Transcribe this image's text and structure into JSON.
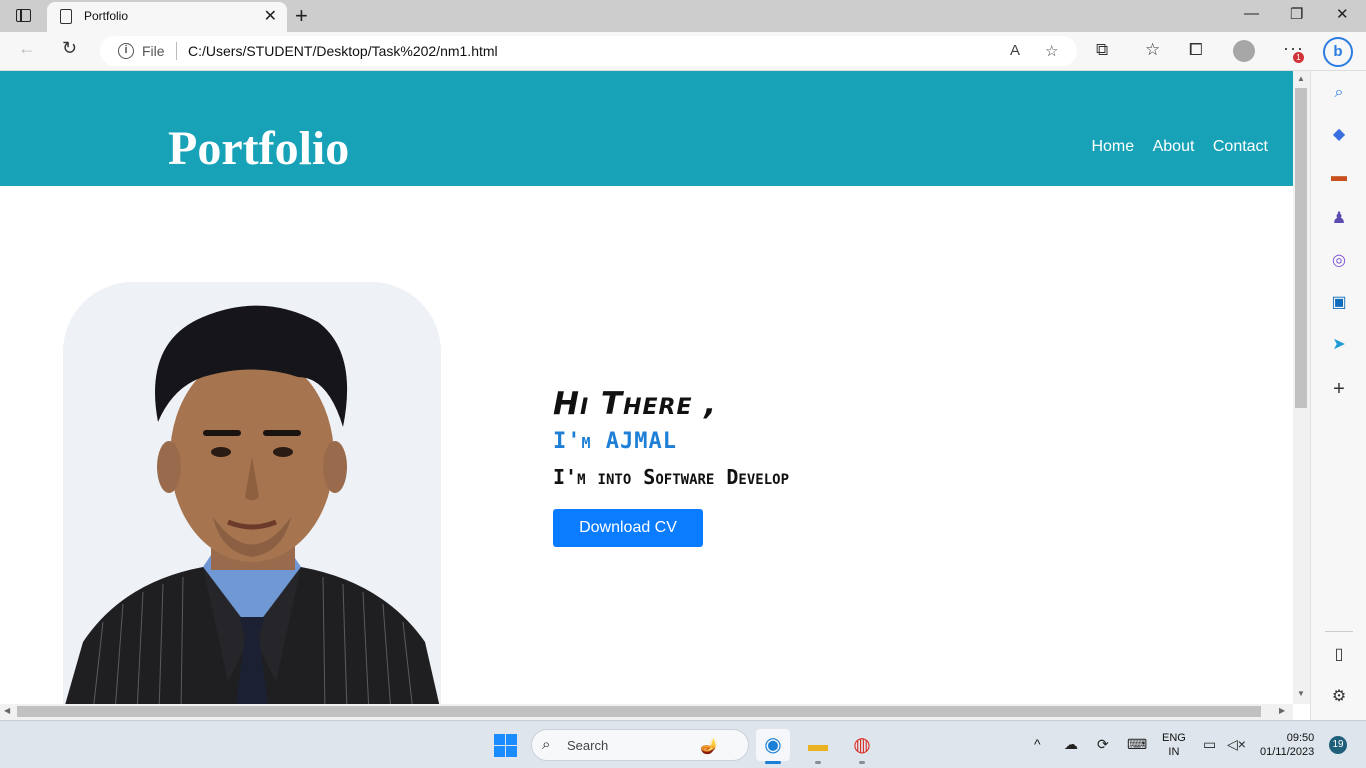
{
  "browser": {
    "tab_title": "Portfolio",
    "tab_close": "✕",
    "new_tab": "+",
    "window_controls": {
      "minimize": "—",
      "restore": "❐",
      "close": "✕"
    },
    "address": {
      "scheme_label": "File",
      "url": "C:/Users/STUDENT/Desktop/Task%202/nm1.html"
    },
    "notification_count": "1",
    "bing_label": "b"
  },
  "site": {
    "logo": "Portfolio",
    "nav": [
      "Home",
      "About",
      "Contact"
    ],
    "hero": {
      "greeting": "Hi There ,",
      "name": "I'm AJMAL",
      "role": "I'm into Software Develop",
      "cta": "Download CV"
    }
  },
  "taskbar": {
    "search_placeholder": "Search",
    "lang_line1": "ENG",
    "lang_line2": "IN",
    "time": "09:50",
    "date": "01/11/2023",
    "notification_count": "19"
  },
  "colors": {
    "header": "#17a2b8",
    "button": "#0a7cff",
    "name_accent": "#1e7fd6"
  }
}
